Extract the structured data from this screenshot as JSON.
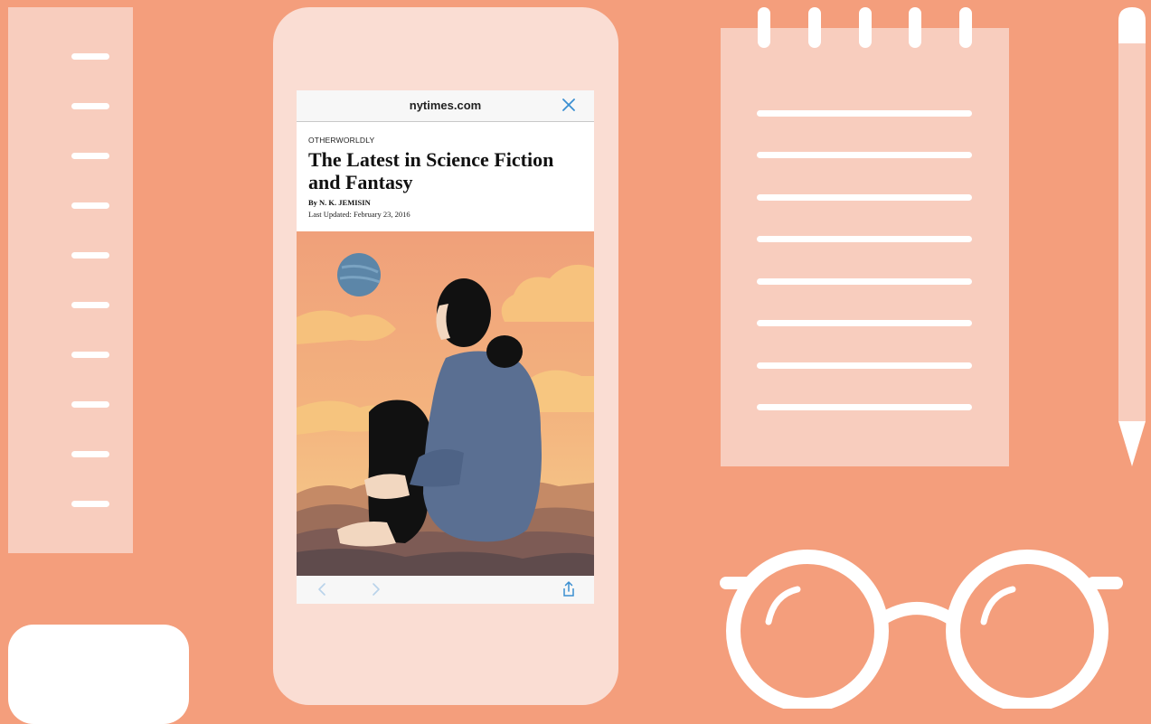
{
  "browser": {
    "url": "nytimes.com"
  },
  "article": {
    "kicker": "OTHERWORLDLY",
    "headline": "The Latest in Science Fiction and Fantasy",
    "byline": "By N. K. JEMISIN",
    "last_updated": "Last Updated: February 23, 2016"
  },
  "colors": {
    "background": "#F49E7C",
    "accent_blue": "#3B8FD1"
  },
  "icons": {
    "close": "close-icon",
    "back": "back-chevron-icon",
    "forward": "forward-chevron-icon",
    "share": "share-icon"
  }
}
